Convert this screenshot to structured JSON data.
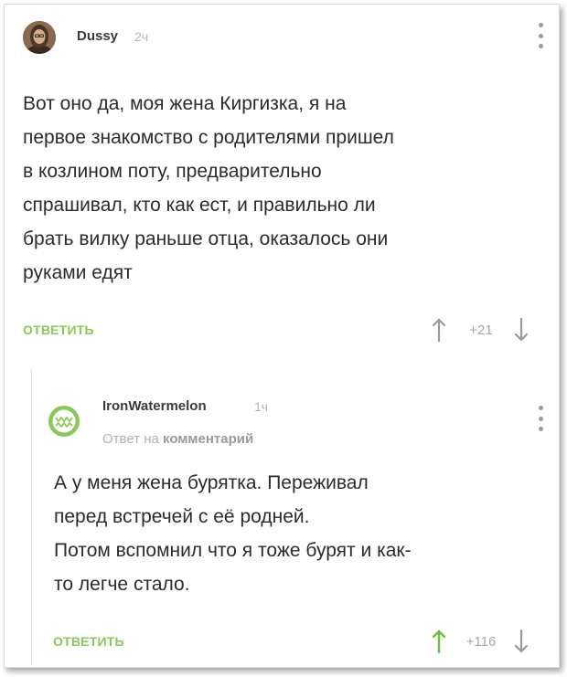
{
  "comments": [
    {
      "author": "Dussy",
      "time": "2ч",
      "body_lines": [
        "Вот оно да, моя жена Киргизка, я на",
        "первое знакомство с родителями пришел",
        "в козлином поту, предварительно",
        "спрашивал, кто как ест, и правильно ли",
        "брать вилку раньше отца, оказалось они",
        "руками едят"
      ],
      "reply_label": "ОТВЕТИТЬ",
      "score": "+21"
    },
    {
      "author": "IronWatermelon",
      "time": "1ч",
      "reply_to_prefix": "Ответ на",
      "reply_to_target": "комментарий",
      "body_lines": [
        "А у меня жена бурятка. Переживал",
        "перед встречей с её родней.",
        "Потом вспомнил что я тоже бурят и как-",
        "то легче стало."
      ],
      "reply_label": "ОТВЕТИТЬ",
      "score": "+116"
    }
  ],
  "icons": {
    "upvote": "arrow-up-icon",
    "downvote": "arrow-down-icon",
    "more": "more-vertical-icon"
  },
  "colors": {
    "accent_green": "#8ac858",
    "upvote_active": "#6cbf3a",
    "neutral_arrow": "#9a9a9a"
  }
}
